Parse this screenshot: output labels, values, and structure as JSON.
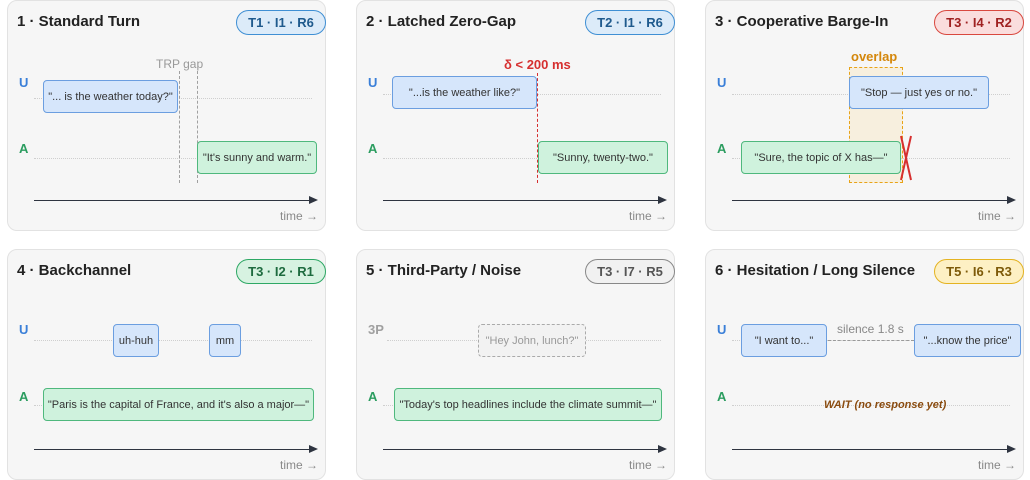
{
  "panels": [
    {
      "title": "1 · Standard Turn",
      "badge": "T1 · I1 · R6",
      "u_label": "U",
      "a_label": "A",
      "u_text": "\"... is the weather today?\"",
      "a_text": "\"It's sunny and warm.\"",
      "note": "TRP gap",
      "time": "time →"
    },
    {
      "title": "2 · Latched Zero-Gap",
      "badge": "T2 · I1 · R6",
      "u_label": "U",
      "a_label": "A",
      "u_text": "\"...is the weather like?\"",
      "a_text": "\"Sunny, twenty-two.\"",
      "note": "δ < 200 ms",
      "time": "time →"
    },
    {
      "title": "3 · Cooperative Barge-In",
      "badge": "T3 · I4 · R2",
      "u_label": "U",
      "a_label": "A",
      "u_text": "\"Stop — just yes or no.\"",
      "a_text": "\"Sure, the topic of X has—\"",
      "note": "overlap",
      "time": "time →"
    },
    {
      "title": "4 · Backchannel",
      "badge": "T3 · I2 · R1",
      "u_label": "U",
      "a_label": "A",
      "u_text_1": "uh-huh",
      "u_text_2": "mm",
      "a_text": "\"Paris is the capital of France, and it's also a major—\"",
      "time": "time →"
    },
    {
      "title": "5 · Third-Party / Noise",
      "badge": "T3 · I7 · R5",
      "tp_label": "3P",
      "a_label": "A",
      "tp_text": "\"Hey John, lunch?\"",
      "a_text": "\"Today's top headlines include the climate summit—\"",
      "time": "time →"
    },
    {
      "title": "6 · Hesitation / Long Silence",
      "badge": "T5 · I6 · R3",
      "u_label": "U",
      "a_label": "A",
      "u_text_1": "\"I want to...\"",
      "u_text_2": "\"...know the price\"",
      "note": "silence 1.8 s",
      "a_text": "WAIT (no response yet)",
      "time": "time →"
    }
  ],
  "colors": {
    "user": "#3a7fd8",
    "assistant": "#2c9d60",
    "latch": "#d62f2f",
    "overlap": "#e8a317",
    "wait": "#8a4b0f"
  }
}
